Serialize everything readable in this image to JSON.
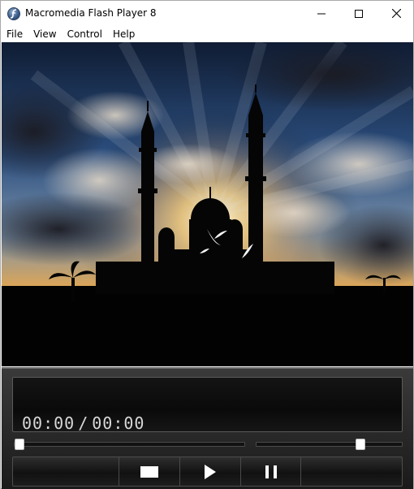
{
  "window": {
    "title": "Macromedia Flash Player 8",
    "icon": "flash-player-icon"
  },
  "menu": {
    "items": [
      "File",
      "View",
      "Control",
      "Help"
    ]
  },
  "video": {
    "description_icon": "video-frame"
  },
  "player": {
    "time_current": "00:00",
    "time_separator": "/",
    "time_total": "00:00",
    "seek_position": 0.0,
    "volume_level": 0.73,
    "buttons": {
      "stop": "stop-icon",
      "play": "play-icon",
      "pause": "pause-icon"
    }
  },
  "colors": {
    "panel_bg": "#1a1a1a",
    "display_text": "#d8d8d8",
    "thumb": "#ffffff"
  }
}
